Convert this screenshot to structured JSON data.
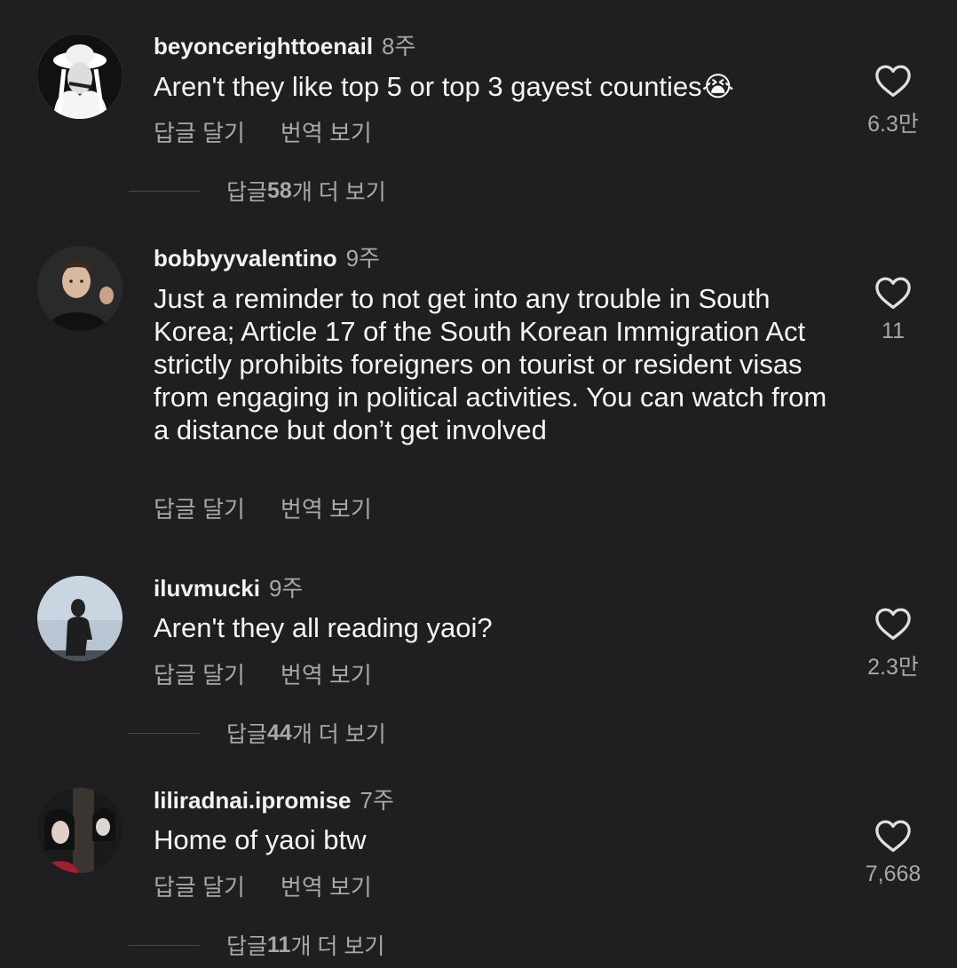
{
  "comments": [
    {
      "username": "beyoncerighttoenail",
      "time": "8주",
      "text": "Aren't they like top 5 or top 3 gayest counties😭",
      "reply_label": "답글 달기",
      "translate_label": "번역 보기",
      "likes": "6.3만",
      "replies_prefix": "답글 ",
      "replies_count": "58",
      "replies_suffix": "개 더 보기"
    },
    {
      "username": "bobbyyvalentino",
      "time": "9주",
      "text": "Just a reminder to not get into any trouble in South Korea; Article 17 of the South Korean Immigration Act strictly prohibits foreigners on tourist or resident visas from engaging in political activities. You can watch from a distance but don’t get involved",
      "reply_label": "답글 달기",
      "translate_label": "번역 보기",
      "likes": "11"
    },
    {
      "username": "iluvmucki",
      "time": "9주",
      "text": "Aren't they all reading yaoi?",
      "reply_label": "답글 달기",
      "translate_label": "번역 보기",
      "likes": "2.3만",
      "replies_prefix": "답글 ",
      "replies_count": "44",
      "replies_suffix": "개 더 보기"
    },
    {
      "username": "liliradnai.ipromise",
      "time": "7주",
      "text": "Home of yaoi btw",
      "reply_label": "답글 달기",
      "translate_label": "번역 보기",
      "likes": "7,668",
      "replies_prefix": "답글 ",
      "replies_count": "11",
      "replies_suffix": "개 더 보기"
    }
  ],
  "icons": {
    "like": "heart-outline-icon"
  },
  "colors": {
    "background": "#1f1f22",
    "secondary_text": "#a8a8a8",
    "primary_text": "#f5f5f5"
  }
}
